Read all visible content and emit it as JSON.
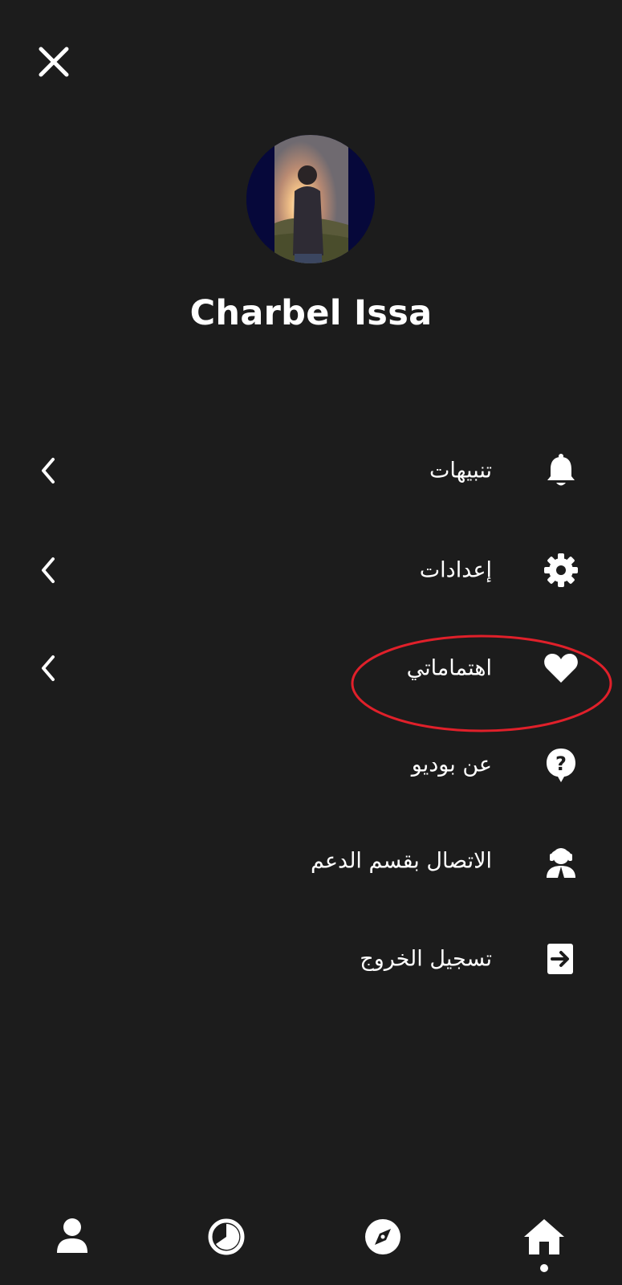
{
  "header": {
    "close_icon": "close-icon"
  },
  "profile": {
    "name": "Charbel Issa",
    "avatar_bg": "#06083a"
  },
  "menu": [
    {
      "label": "تنبيهات",
      "icon": "bell-icon",
      "chevron": true
    },
    {
      "label": "إعدادات",
      "icon": "gear-icon",
      "chevron": true
    },
    {
      "label": "اهتماماتي",
      "icon": "heart-icon",
      "chevron": true,
      "highlighted": true
    },
    {
      "label": "عن بوديو",
      "icon": "help-bubble-icon",
      "chevron": false
    },
    {
      "label": "الاتصال بقسم الدعم",
      "icon": "support-agent-icon",
      "chevron": false
    },
    {
      "label": "تسجيل الخروج",
      "icon": "logout-icon",
      "chevron": false
    }
  ],
  "annotation": {
    "color": "#e0202a"
  },
  "bottom_nav": [
    {
      "icon": "person-icon"
    },
    {
      "icon": "timer-icon"
    },
    {
      "icon": "compass-icon"
    },
    {
      "icon": "home-icon",
      "active": true
    }
  ],
  "colors": {
    "background": "#1c1c1c",
    "foreground": "#ffffff"
  }
}
